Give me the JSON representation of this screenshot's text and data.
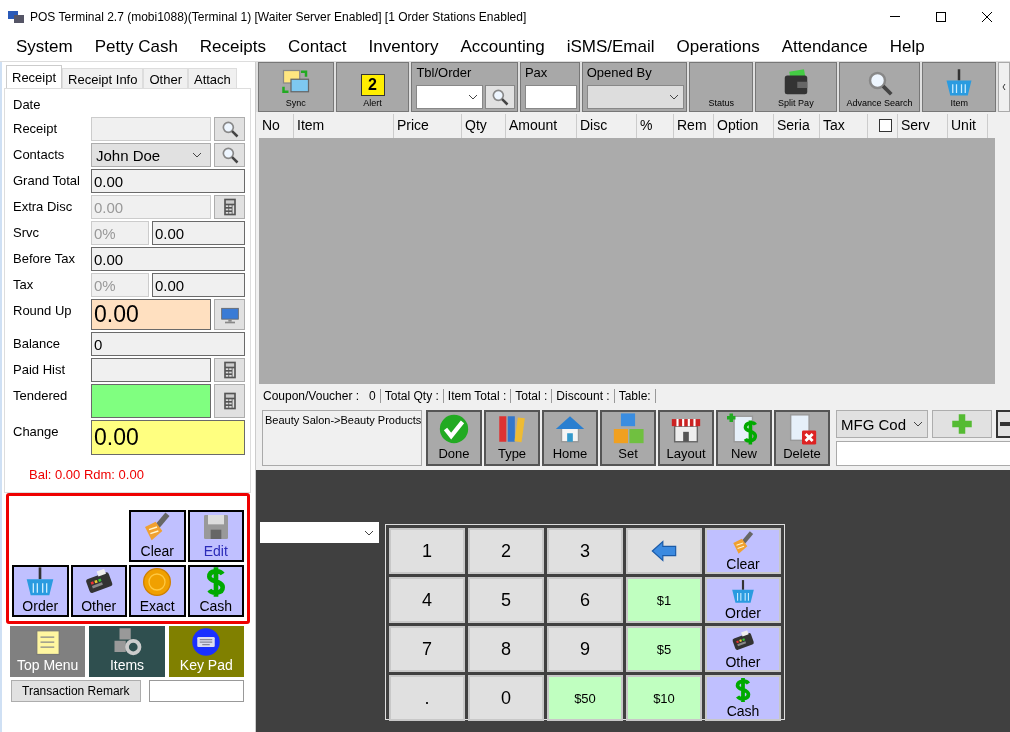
{
  "window": {
    "title": "POS Terminal 2.7 (mobi1088)(Terminal 1) [Waiter Server Enabled] [1 Order Stations Enabled]"
  },
  "menu": [
    "System",
    "Petty Cash",
    "Receipts",
    "Contact",
    "Inventory",
    "Accounting",
    "iSMS/Email",
    "Operations",
    "Attendance",
    "Help"
  ],
  "form_tabs": [
    {
      "label": "Receipt",
      "selected": true
    },
    {
      "label": "Receipt Info",
      "selected": false
    },
    {
      "label": "Other",
      "selected": false
    },
    {
      "label": "Attach",
      "selected": false
    }
  ],
  "form_fields": [
    {
      "label": "Date",
      "kind": "label"
    },
    {
      "label": "Receipt",
      "kind": "field",
      "disabled": true
    },
    {
      "label": "Contacts",
      "kind": "combo",
      "value": "John Doe"
    },
    {
      "label": "Grand Total",
      "kind": "field",
      "value": "0.00"
    },
    {
      "label": "Extra Disc",
      "kind": "field",
      "value": "0.00",
      "disabled": true
    },
    {
      "label": "Srvc",
      "kind": "split",
      "rate": "0%",
      "value": "0.00"
    },
    {
      "label": "Before Tax",
      "kind": "field",
      "value": "0.00"
    },
    {
      "label": "Tax",
      "kind": "split",
      "rate": "0%",
      "value": "0.00"
    },
    {
      "label": "Round Up",
      "kind": "big",
      "value": "0.00",
      "color": "#ffe0c0"
    },
    {
      "label": "Balance",
      "kind": "field",
      "value": "0"
    },
    {
      "label": "Paid Hist",
      "kind": "field"
    },
    {
      "label": "Tendered",
      "kind": "tall",
      "color": "#80ff80"
    },
    {
      "label": "Change",
      "kind": "big",
      "value": "0.00",
      "color": "#ffff80"
    }
  ],
  "balance_line": "Bal: 0.00 Rdm: 0.00",
  "pay_buttons": [
    {
      "label": "Clear",
      "disabled": false
    },
    {
      "label": "Edit",
      "disabled": true
    },
    {
      "label": "Order",
      "disabled": false
    },
    {
      "label": "Other",
      "disabled": false
    },
    {
      "label": "Exact",
      "disabled": false
    },
    {
      "label": "Cash",
      "disabled": false
    }
  ],
  "tiles": [
    {
      "label": "Top Menu",
      "color": "#808080"
    },
    {
      "label": "Items",
      "color": "#2f4f4f"
    },
    {
      "label": "Key Pad",
      "color": "#808000"
    }
  ],
  "remark": {
    "button": "Transaction Remark"
  },
  "toolbar": [
    {
      "kind": "button",
      "label": "Sync"
    },
    {
      "kind": "alert",
      "label": "Alert",
      "badge": "2"
    },
    {
      "kind": "combo_search",
      "label": "Tbl/Order"
    },
    {
      "kind": "input",
      "label": "Pax"
    },
    {
      "kind": "combo",
      "label": "Opened By",
      "disabled": true
    },
    {
      "kind": "button",
      "label": "Status"
    },
    {
      "kind": "button",
      "label": "Split Pay"
    },
    {
      "kind": "button",
      "label": "Advance Search"
    },
    {
      "kind": "button",
      "label": "Item"
    }
  ],
  "table": {
    "columns": [
      {
        "kind": "text",
        "label": "No"
      },
      {
        "kind": "text",
        "label": "Item"
      },
      {
        "kind": "text",
        "label": "Price"
      },
      {
        "kind": "text",
        "label": "Qty"
      },
      {
        "kind": "text",
        "label": "Amount"
      },
      {
        "kind": "text",
        "label": "Disc"
      },
      {
        "kind": "text",
        "label": "%"
      },
      {
        "kind": "text",
        "label": "Rem"
      },
      {
        "kind": "text",
        "label": "Option"
      },
      {
        "kind": "text",
        "label": "Seria"
      },
      {
        "kind": "text",
        "label": "Tax"
      },
      {
        "kind": "checkbox",
        "checked": false
      },
      {
        "kind": "text",
        "label": "Serv"
      },
      {
        "kind": "text",
        "label": "Unit"
      }
    ]
  },
  "summary": [
    {
      "label": "Coupon/Voucher :",
      "value": "0"
    },
    {
      "label": "Total Qty :"
    },
    {
      "label": "Item Total :"
    },
    {
      "label": "Total :"
    },
    {
      "label": "Discount :"
    },
    {
      "label": "Table:"
    }
  ],
  "category_path": "Beauty Salon->Beauty Products",
  "actions": [
    {
      "label": "Done"
    },
    {
      "label": "Type"
    },
    {
      "label": "Home"
    },
    {
      "label": "Set"
    },
    {
      "label": "Layout"
    },
    {
      "label": "New"
    },
    {
      "label": "Delete"
    }
  ],
  "code_combo": {
    "value": "MFG Cod"
  },
  "keypad": [
    {
      "kind": "digit",
      "label": "1"
    },
    {
      "kind": "digit",
      "label": "2"
    },
    {
      "kind": "digit",
      "label": "3"
    },
    {
      "kind": "back"
    },
    {
      "kind": "action",
      "label": "Clear"
    },
    {
      "kind": "digit",
      "label": "4"
    },
    {
      "kind": "digit",
      "label": "5"
    },
    {
      "kind": "digit",
      "label": "6"
    },
    {
      "kind": "cash",
      "label": "$1"
    },
    {
      "kind": "action",
      "label": "Order"
    },
    {
      "kind": "digit",
      "label": "7"
    },
    {
      "kind": "digit",
      "label": "8"
    },
    {
      "kind": "digit",
      "label": "9"
    },
    {
      "kind": "cash",
      "label": "$5"
    },
    {
      "kind": "action",
      "label": "Other"
    },
    {
      "kind": "digit",
      "label": "."
    },
    {
      "kind": "digit",
      "label": "0"
    },
    {
      "kind": "cash",
      "label": "$50"
    },
    {
      "kind": "cash",
      "label": "$10"
    },
    {
      "kind": "action",
      "label": "Cash"
    }
  ]
}
